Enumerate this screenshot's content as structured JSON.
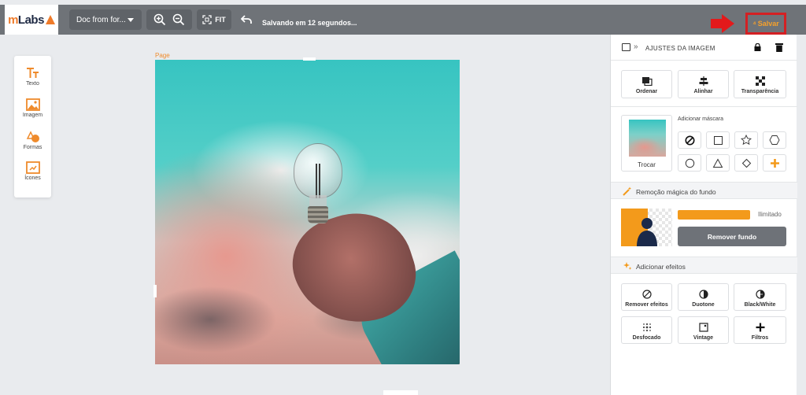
{
  "topbar": {
    "brand_prefix": "m",
    "brand_rest": "Labs",
    "document_name": "Doc from for...",
    "fit_label": "FIT",
    "saving_status": "Salvando em 12 segundos...",
    "save_label": "Salvar"
  },
  "tools": [
    {
      "label": "Texto",
      "icon": "text-icon"
    },
    {
      "label": "Imagem",
      "icon": "image-icon"
    },
    {
      "label": "Formas",
      "icon": "shapes-icon"
    },
    {
      "label": "Ícones",
      "icon": "icons-icon"
    }
  ],
  "canvas": {
    "page_label": "Page"
  },
  "panel": {
    "title": "AJUSTES DA IMAGEM",
    "actions": [
      {
        "label": "Ordenar",
        "icon": "order-icon"
      },
      {
        "label": "Alinhar",
        "icon": "align-icon"
      },
      {
        "label": "Transparência",
        "icon": "transparency-icon"
      }
    ],
    "mask": {
      "title": "Adicionar máscara",
      "swap_label": "Trocar",
      "shapes": [
        "none",
        "square",
        "star",
        "hexagon",
        "circle",
        "triangle",
        "diamond",
        "add"
      ]
    },
    "magic_removal": {
      "title": "Remoção mágica do fundo",
      "limit_label": "Ilimitado",
      "progress": 1.0,
      "button_label": "Remover fundo"
    },
    "effects": {
      "title": "Adicionar efeitos",
      "items": [
        {
          "label": "Remover efeitos",
          "icon": "no-effect-icon"
        },
        {
          "label": "Duotone",
          "icon": "duotone-icon"
        },
        {
          "label": "Black/White",
          "icon": "black-white-icon"
        },
        {
          "label": "Desfocado",
          "icon": "blur-icon"
        },
        {
          "label": "Vintage",
          "icon": "vintage-icon"
        },
        {
          "label": "Filtros",
          "icon": "filters-icon"
        }
      ]
    }
  },
  "colors": {
    "accent": "#f39a1b",
    "topbar": "#6f7378",
    "highlight_red": "#e3191b"
  }
}
